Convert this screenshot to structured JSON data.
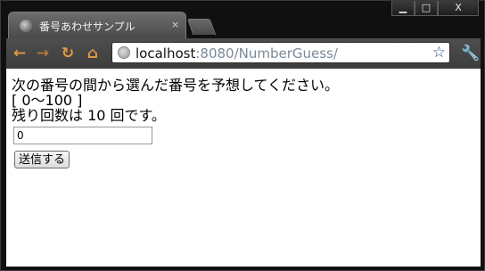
{
  "window": {
    "controls": {
      "minimize": "▁",
      "maximize": "□",
      "close": "X"
    }
  },
  "tab": {
    "title": "番号あわせサンプル",
    "close": "×"
  },
  "toolbar": {
    "back_icon": "←",
    "forward_icon": "→",
    "reload_icon": "↻",
    "home_icon": "⌂",
    "url_host": "localhost",
    "url_rest": ":8080/NumberGuess/",
    "star_icon": "☆",
    "wrench_icon": "🔧"
  },
  "page": {
    "instruction": "次の番号の間から選んだ番号を予想してください。",
    "range": "[ 0〜100 ]",
    "remaining": "残り回数は 10 回です。",
    "input_value": "0",
    "submit_label": "送信する"
  },
  "colors": {
    "frame": "#101010",
    "toolbar": "#474747",
    "nav_icon": "#e39a3c"
  }
}
